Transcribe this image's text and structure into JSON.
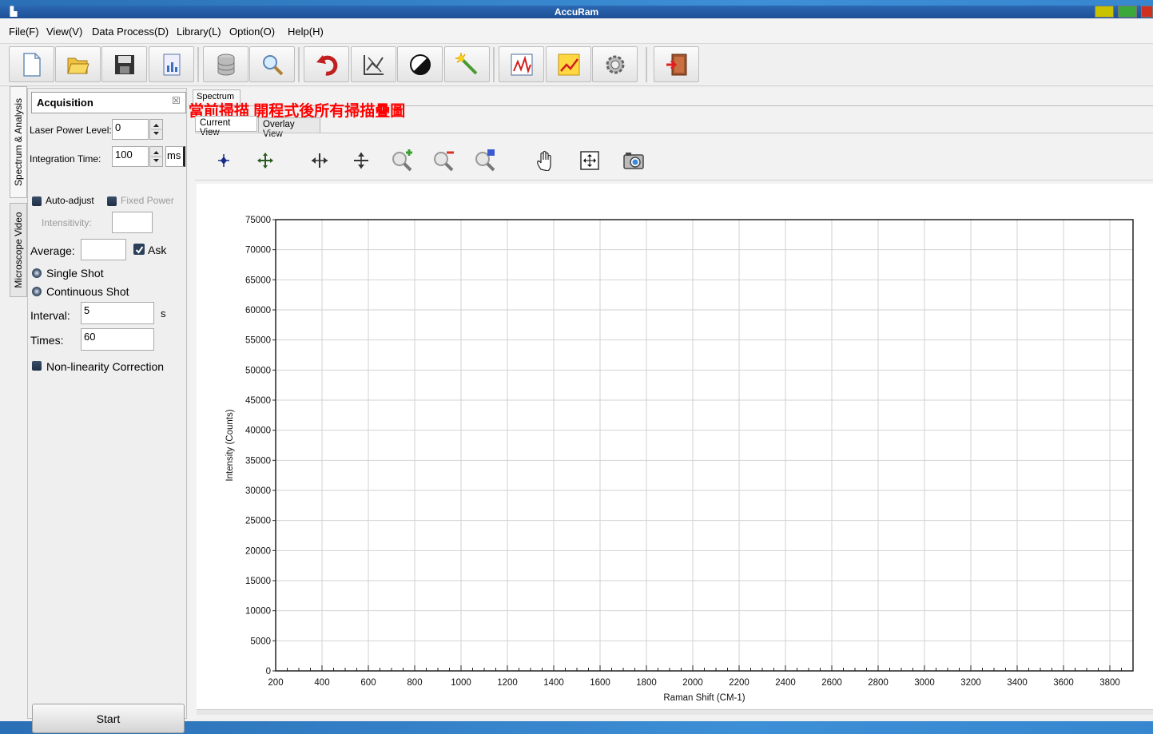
{
  "window": {
    "title": "AccuRam"
  },
  "menu": [
    "File(F)",
    "View(V)",
    "Data Process(D)",
    "Library(L)",
    "Option(O)",
    "Help(H)"
  ],
  "toolbar": {
    "buttons": [
      "new-file-icon",
      "open-folder-icon",
      "save-icon",
      "report-icon",
      "database-icon",
      "search-icon",
      "undo-icon",
      "chart-edit-icon",
      "contrast-icon",
      "magic-wand-icon",
      "spectrum-chart-icon",
      "trend-chart-icon",
      "settings-gear-icon",
      "exit-door-icon"
    ]
  },
  "side_tabs": {
    "spectrum": "Spectrum & Analysis",
    "video": "Microscope Video"
  },
  "acquisition": {
    "title": "Acquisition",
    "laser_power_label": "Laser Power Level:",
    "laser_power_value": "0",
    "integration_label": "Integration Time:",
    "integration_value": "100",
    "integration_unit": "ms",
    "auto_adjust": "Auto-adjust",
    "fixed_power": "Fixed Power",
    "intensitivity_label": "Intensitivity:",
    "intensitivity_value": "",
    "average_label": "Average:",
    "average_value": "",
    "ask": "Ask",
    "ask_checked": true,
    "single_shot": "Single Shot",
    "continuous_shot": "Continuous Shot",
    "interval_label": "Interval:",
    "interval_value": "5",
    "interval_unit": "s",
    "times_label": "Times:",
    "times_value": "60",
    "nonlinearity": "Non-linearity Correction",
    "start": "Start"
  },
  "spectrum": {
    "panel_tab": "Spectrum",
    "annotation": "當前掃描 開程式後所有掃描疊圖",
    "tab_current": "Current View",
    "tab_overlay": "Overlay View"
  },
  "colors": {
    "annotation": "#ff0000",
    "titlebar": "#1e4f95"
  },
  "chart_data": {
    "type": "line",
    "xlabel": "Raman Shift (CM-1)",
    "ylabel": "Intensity (Counts)",
    "xlim": [
      200,
      3900
    ],
    "ylim": [
      0,
      75000
    ],
    "x_ticks": [
      200,
      400,
      600,
      800,
      1000,
      1200,
      1400,
      1600,
      1800,
      2000,
      2200,
      2400,
      2600,
      2800,
      3000,
      3200,
      3400,
      3600,
      3800
    ],
    "y_ticks": [
      0,
      5000,
      10000,
      15000,
      20000,
      25000,
      30000,
      35000,
      40000,
      45000,
      50000,
      55000,
      60000,
      65000,
      70000,
      75000
    ],
    "series": [],
    "grid": true
  }
}
